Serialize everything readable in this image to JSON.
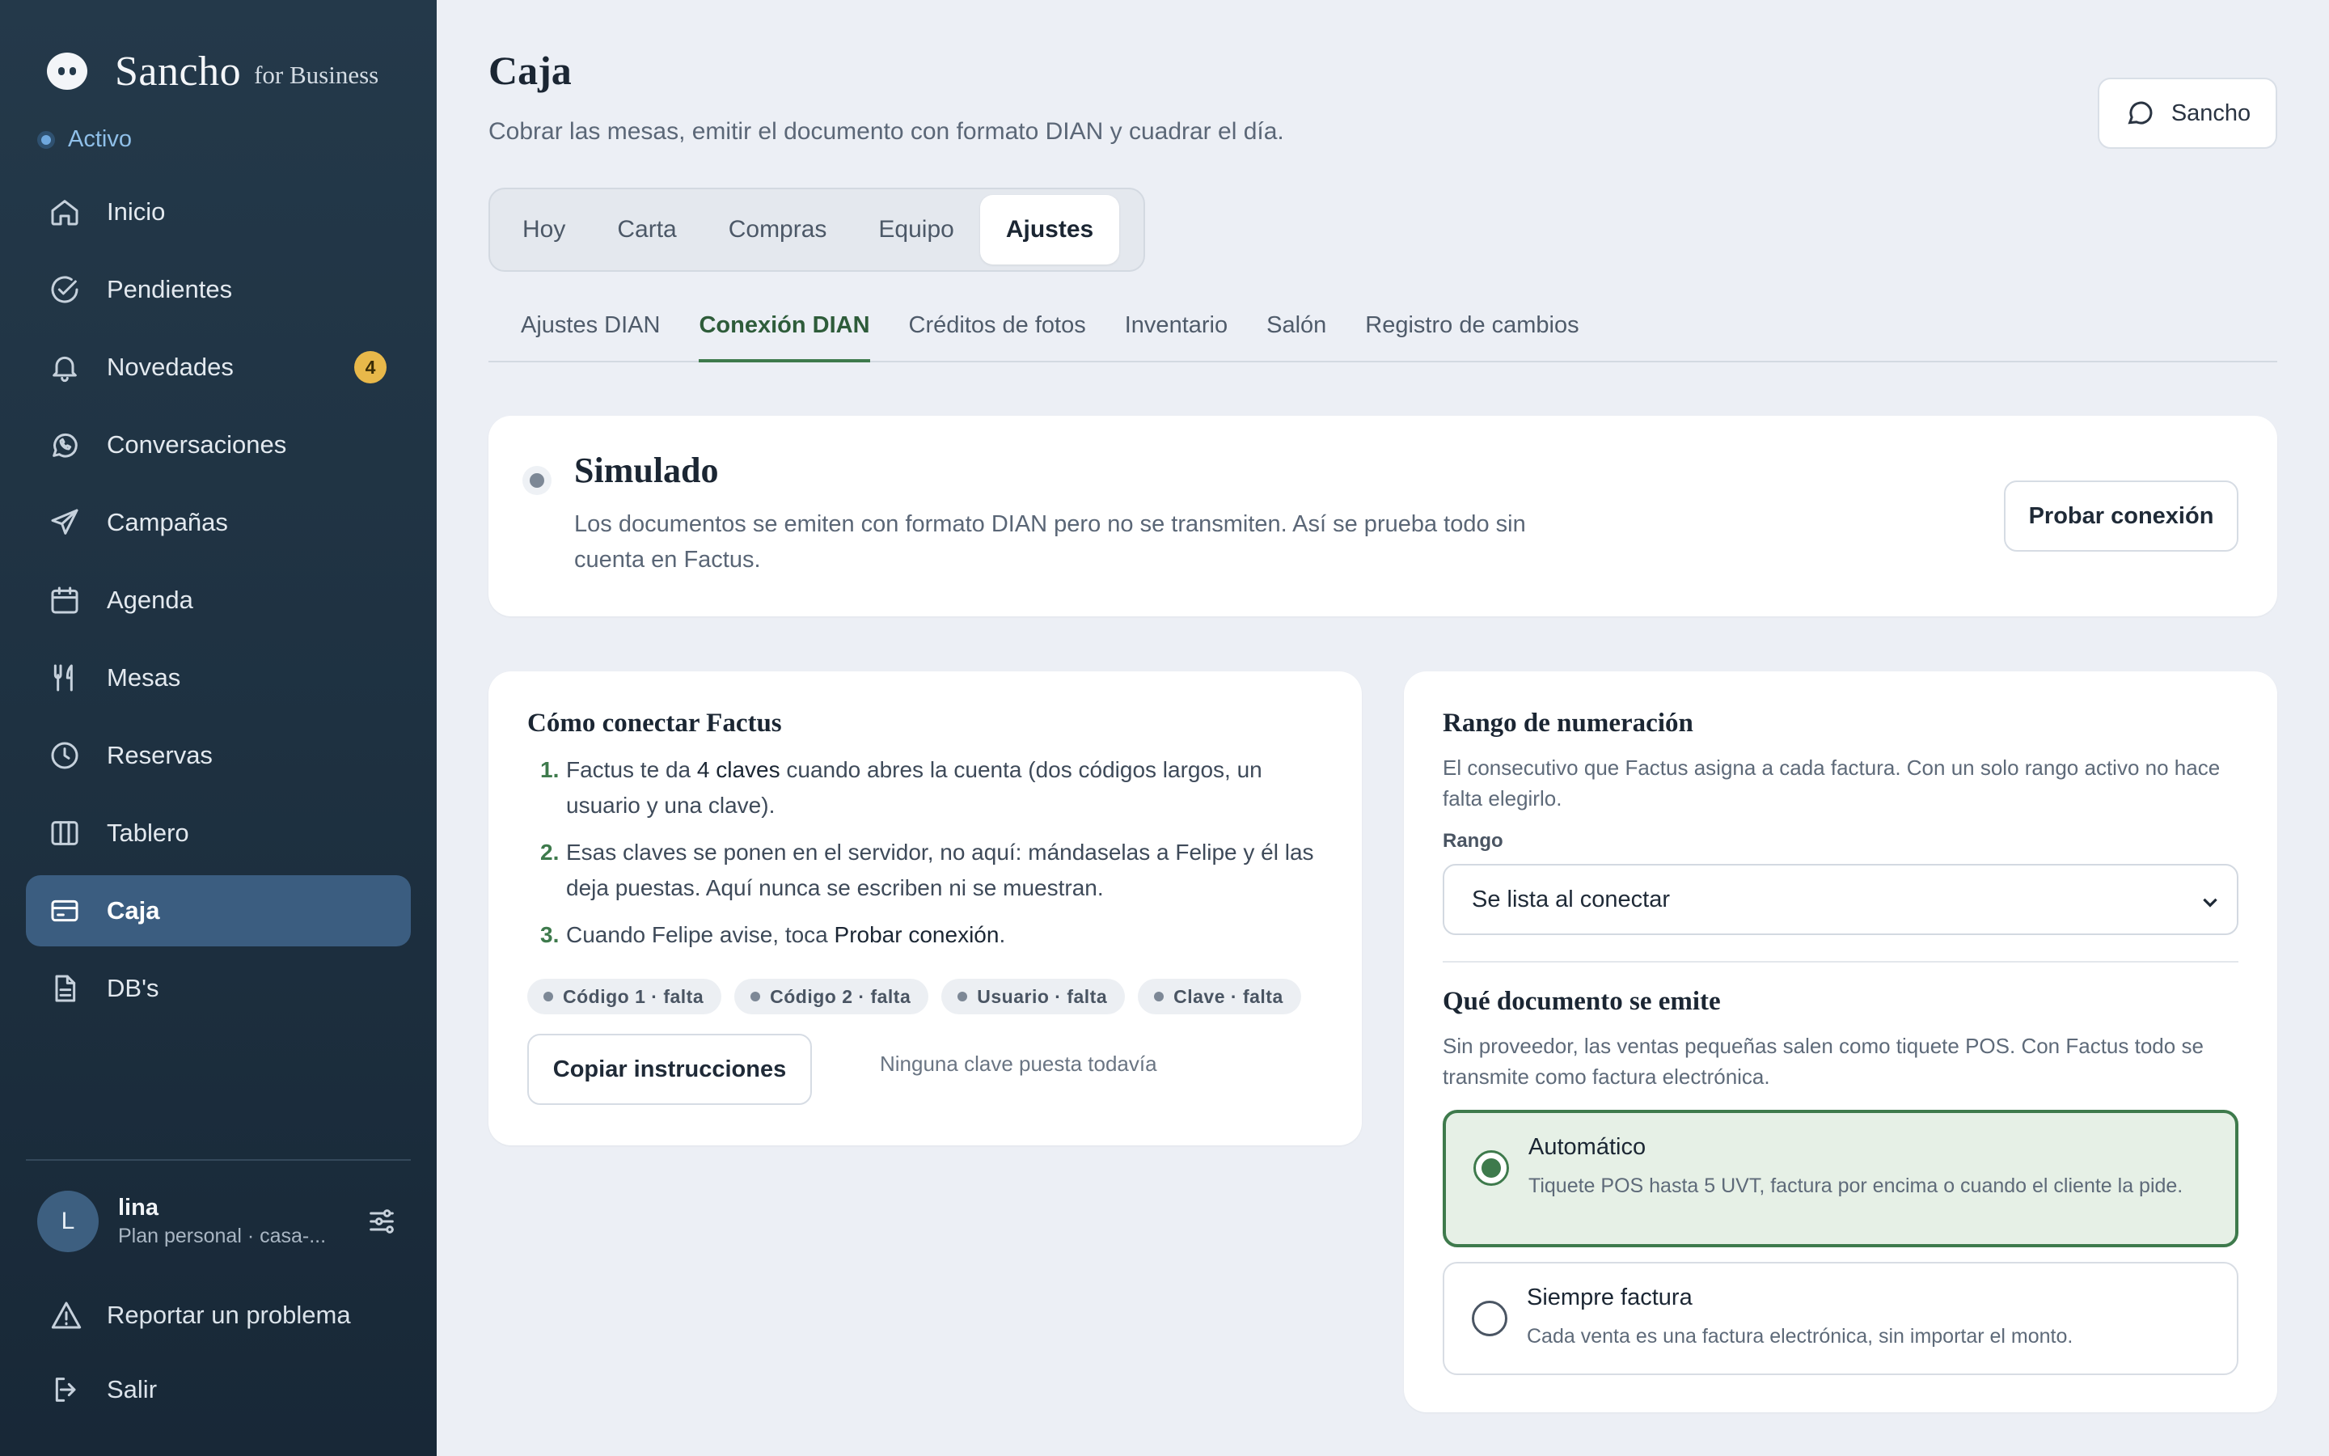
{
  "brand": {
    "name": "Sancho",
    "suffix": "for Business"
  },
  "status": "Activo",
  "nav": [
    {
      "label": "Inicio",
      "icon": "home-icon"
    },
    {
      "label": "Pendientes",
      "icon": "check-circle-icon"
    },
    {
      "label": "Novedades",
      "icon": "bell-icon",
      "badge": "4"
    },
    {
      "label": "Conversaciones",
      "icon": "whatsapp-icon"
    },
    {
      "label": "Campañas",
      "icon": "send-icon"
    },
    {
      "label": "Agenda",
      "icon": "calendar-icon"
    },
    {
      "label": "Mesas",
      "icon": "utensils-icon"
    },
    {
      "label": "Reservas",
      "icon": "clock-icon"
    },
    {
      "label": "Tablero",
      "icon": "columns-icon"
    },
    {
      "label": "Caja",
      "icon": "credit-card-icon",
      "active": true
    },
    {
      "label": "DB's",
      "icon": "file-icon"
    }
  ],
  "user": {
    "initial": "L",
    "name": "lina",
    "plan": "Plan personal · casa-..."
  },
  "footer_links": {
    "report": "Reportar un problema",
    "logout": "Salir"
  },
  "page": {
    "title": "Caja",
    "subtitle": "Cobrar las mesas, emitir el documento con formato DIAN y cuadrar el día.",
    "assistant_button": "Sancho"
  },
  "tabs": [
    "Hoy",
    "Carta",
    "Compras",
    "Equipo",
    "Ajustes"
  ],
  "active_tab": "Ajustes",
  "subtabs": [
    "Ajustes DIAN",
    "Conexión DIAN",
    "Créditos de fotos",
    "Inventario",
    "Salón",
    "Registro de cambios"
  ],
  "active_subtab": "Conexión DIAN",
  "simulated": {
    "title": "Simulado",
    "text": "Los documentos se emiten con formato DIAN pero no se transmiten. Así se prueba todo sin cuenta en Factus.",
    "button": "Probar conexión"
  },
  "howto": {
    "title": "Cómo conectar Factus",
    "steps": [
      {
        "num": "1.",
        "pre": "Factus te da ",
        "bold": "4 claves",
        "post": " cuando abres la cuenta (dos códigos largos, un usuario y una clave)."
      },
      {
        "num": "2.",
        "pre": "Esas claves se ponen en el servidor, no aquí: mándaselas a Felipe y él las deja puestas. Aquí nunca se escriben ni se muestran.",
        "bold": "",
        "post": ""
      },
      {
        "num": "3.",
        "pre": "Cuando Felipe avise, toca ",
        "bold": "Probar conexión",
        "post": "."
      }
    ],
    "chips": [
      "Código 1 · falta",
      "Código 2 · falta",
      "Usuario · falta",
      "Clave · falta"
    ],
    "copy_button": "Copiar instrucciones",
    "hint": "Ninguna clave puesta todavía"
  },
  "range": {
    "title": "Rango de numeración",
    "desc": "El consecutivo que Factus asigna a cada factura. Con un solo rango activo no hace falta elegirlo.",
    "field_label": "Rango",
    "select_value": "Se lista al conectar",
    "doc_title": "Qué documento se emite",
    "doc_desc": "Sin proveedor, las ventas pequeñas salen como tiquete POS. Con Factus todo se transmite como factura electrónica.",
    "options": [
      {
        "title": "Automático",
        "desc": "Tiquete POS hasta 5 UVT, factura por encima o cuando el cliente la pide.",
        "selected": true
      },
      {
        "title": "Siempre factura",
        "desc": "Cada venta es una factura electrónica, sin importar el monto.",
        "selected": false
      }
    ]
  },
  "colors": {
    "sidebar": "#1e3141",
    "accent_green": "#3e7a4c",
    "active_nav": "#3b5d80",
    "badge": "#e8b84a"
  }
}
